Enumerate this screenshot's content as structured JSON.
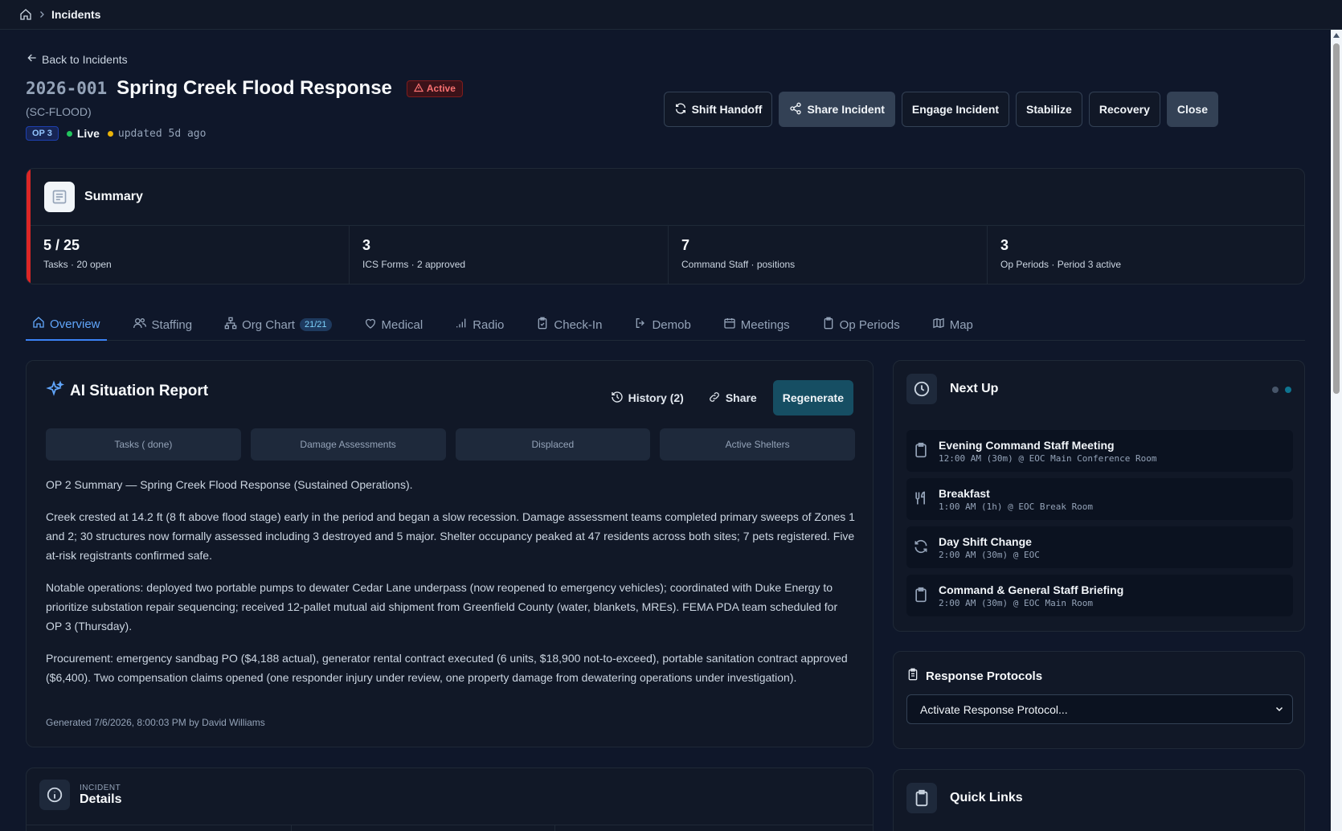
{
  "breadcrumb": {
    "current": "Incidents"
  },
  "back_link": "Back to Incidents",
  "incident": {
    "number": "2026-001",
    "title": "Spring Creek Flood Response",
    "status": "Active",
    "code": "(SC-FLOOD)",
    "op_badge": "OP 3",
    "live_label": "Live",
    "updated": "updated 5d ago"
  },
  "actions": {
    "shift_handoff": "Shift Handoff",
    "share_incident": "Share Incident",
    "engage": "Engage Incident",
    "stabilize": "Stabilize",
    "recovery": "Recovery",
    "close": "Close"
  },
  "summary": {
    "title": "Summary",
    "stats": [
      {
        "value": "5 / 25",
        "label": "Tasks · 20 open"
      },
      {
        "value": "3",
        "label": "ICS Forms · 2 approved"
      },
      {
        "value": "7",
        "label": "Command Staff · positions"
      },
      {
        "value": "3",
        "label": "Op Periods · Period 3 active"
      }
    ]
  },
  "tabs": {
    "overview": "Overview",
    "staffing": "Staffing",
    "org_chart": "Org Chart",
    "org_chart_count": "21/21",
    "medical": "Medical",
    "radio": "Radio",
    "checkin": "Check-In",
    "demob": "Demob",
    "meetings": "Meetings",
    "op_periods": "Op Periods",
    "map": "Map"
  },
  "report": {
    "title": "AI Situation Report",
    "history": "History (2)",
    "share": "Share",
    "regenerate": "Regenerate",
    "chips": [
      "Tasks ( done)",
      "Damage Assessments",
      "Displaced",
      "Active Shelters"
    ],
    "paragraphs": [
      "OP 2 Summary — Spring Creek Flood Response (Sustained Operations).",
      "Creek crested at 14.2 ft (8 ft above flood stage) early in the period and began a slow recession. Damage assessment teams completed primary sweeps of Zones 1 and 2; 30 structures now formally assessed including 3 destroyed and 5 major. Shelter occupancy peaked at 47 residents across both sites; 7 pets registered. Five at-risk registrants confirmed safe.",
      "Notable operations: deployed two portable pumps to dewater Cedar Lane underpass (now reopened to emergency vehicles); coordinated with Duke Energy to prioritize substation repair sequencing; received 12-pallet mutual aid shipment from Greenfield County (water, blankets, MREs). FEMA PDA team scheduled for OP 3 (Thursday).",
      "Procurement: emergency sandbag PO ($4,188 actual), generator rental contract executed (6 units, $18,900 not-to-exceed), portable sanitation contract approved ($6,400). Two compensation claims opened (one responder injury under review, one property damage from dewatering operations under investigation)."
    ],
    "generated": "Generated 7/6/2026, 8:00:03 PM by David Williams"
  },
  "next_up": {
    "title": "Next Up",
    "events": [
      {
        "name": "Evening Command Staff Meeting",
        "detail": "12:00 AM (30m) @ EOC Main Conference Room",
        "icon": "clipboard-icon"
      },
      {
        "name": "Breakfast",
        "detail": "1:00 AM (1h) @ EOC Break Room",
        "icon": "utensils-icon"
      },
      {
        "name": "Day Shift Change",
        "detail": "2:00 AM (30m) @ EOC",
        "icon": "refresh-icon"
      },
      {
        "name": "Command & General Staff Briefing",
        "detail": "2:00 AM (30m) @ EOC Main Room",
        "icon": "clipboard-icon"
      }
    ]
  },
  "protocols": {
    "title": "Response Protocols",
    "selected": "Activate Response Protocol..."
  },
  "details": {
    "kicker": "INCIDENT",
    "title": "Details"
  },
  "quick_links": {
    "title": "Quick Links"
  },
  "colors": {
    "background": "#0f172a",
    "accent": "#3b82f6",
    "active_red": "#dc2626",
    "live_green": "#22c55e",
    "updated_amber": "#eab308"
  }
}
